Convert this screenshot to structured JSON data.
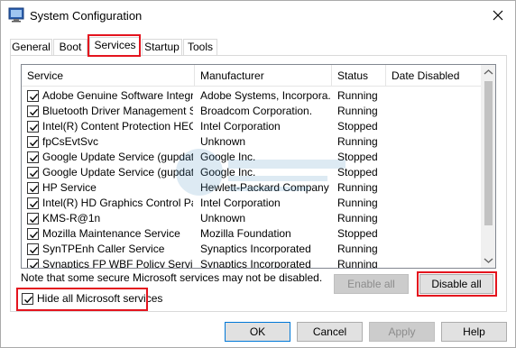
{
  "window": {
    "title": "System Configuration",
    "app_icon": "msconfig-icon",
    "close_icon": "close-icon"
  },
  "tabs": [
    {
      "label": "General",
      "active": false
    },
    {
      "label": "Boot",
      "active": false
    },
    {
      "label": "Services",
      "active": true
    },
    {
      "label": "Startup",
      "active": false
    },
    {
      "label": "Tools",
      "active": false
    }
  ],
  "services_table": {
    "columns": [
      "Service",
      "Manufacturer",
      "Status",
      "Date Disabled"
    ],
    "rows": [
      {
        "checked": true,
        "service": "Adobe Genuine Software Integri...",
        "manufacturer": "Adobe Systems, Incorpora...",
        "status": "Running",
        "date_disabled": ""
      },
      {
        "checked": true,
        "service": "Bluetooth Driver Management S...",
        "manufacturer": "Broadcom Corporation.",
        "status": "Running",
        "date_disabled": ""
      },
      {
        "checked": true,
        "service": "Intel(R) Content Protection HEC...",
        "manufacturer": "Intel Corporation",
        "status": "Stopped",
        "date_disabled": ""
      },
      {
        "checked": true,
        "service": "fpCsEvtSvc",
        "manufacturer": "Unknown",
        "status": "Running",
        "date_disabled": ""
      },
      {
        "checked": true,
        "service": "Google Update Service (gupdate)",
        "manufacturer": "Google Inc.",
        "status": "Stopped",
        "date_disabled": ""
      },
      {
        "checked": true,
        "service": "Google Update Service (gupdatem)",
        "manufacturer": "Google Inc.",
        "status": "Stopped",
        "date_disabled": ""
      },
      {
        "checked": true,
        "service": "HP Service",
        "manufacturer": "Hewlett-Packard Company",
        "status": "Running",
        "date_disabled": ""
      },
      {
        "checked": true,
        "service": "Intel(R) HD Graphics Control Pa...",
        "manufacturer": "Intel Corporation",
        "status": "Running",
        "date_disabled": ""
      },
      {
        "checked": true,
        "service": "KMS-R@1n",
        "manufacturer": "Unknown",
        "status": "Running",
        "date_disabled": ""
      },
      {
        "checked": true,
        "service": "Mozilla Maintenance Service",
        "manufacturer": "Mozilla Foundation",
        "status": "Stopped",
        "date_disabled": ""
      },
      {
        "checked": true,
        "service": "SynTPEnh Caller Service",
        "manufacturer": "Synaptics Incorporated",
        "status": "Running",
        "date_disabled": ""
      },
      {
        "checked": true,
        "service": "Synaptics FP WBF Policy Service",
        "manufacturer": "Synaptics Incorporated",
        "status": "Running",
        "date_disabled": ""
      }
    ]
  },
  "note": "Note that some secure Microsoft services may not be disabled.",
  "buttons": {
    "enable_all": "Enable all",
    "disable_all": "Disable all",
    "ok": "OK",
    "cancel": "Cancel",
    "apply": "Apply",
    "help": "Help"
  },
  "hide_ms": {
    "label": "Hide all Microsoft services",
    "checked": true
  },
  "colors": {
    "highlight": "#e4141e",
    "focus_border": "#0078d7"
  }
}
